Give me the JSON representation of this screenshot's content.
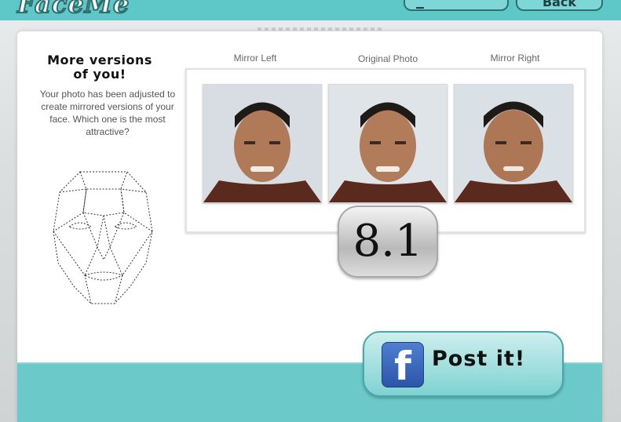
{
  "header": {
    "logo_text": "FaceMe",
    "back_label": "Back"
  },
  "intro": {
    "headline": "More versions of you!",
    "description": "Your photo has been adjusted to create mirrored versions of your face. Which one is the most attractive?"
  },
  "photos": [
    {
      "label": "Mirror Left"
    },
    {
      "label": "Original Photo"
    },
    {
      "label": "Mirror Right"
    }
  ],
  "score": {
    "value": "8.1"
  },
  "share": {
    "label": "Post it!",
    "icon": "facebook-icon"
  },
  "colors": {
    "accent": "#5ec8c8",
    "facebook": "#3b5fb8"
  }
}
